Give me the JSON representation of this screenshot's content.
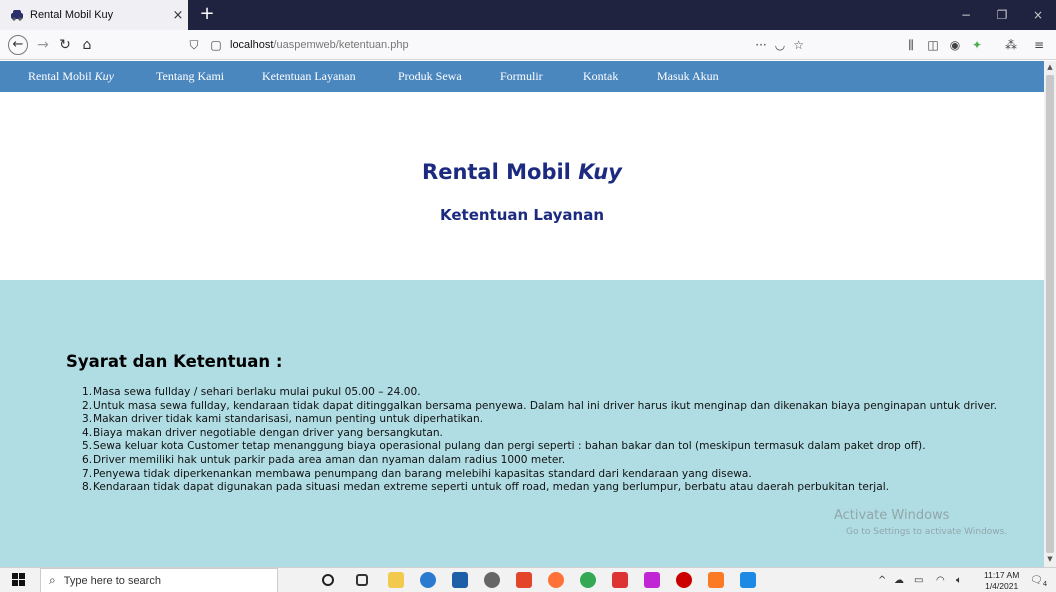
{
  "browser": {
    "tab_title": "Rental Mobil Kuy",
    "tab_close": "×",
    "new_tab": "+",
    "url_host": "localhost",
    "url_path": "/uaspemweb/ketentuan.php",
    "url_menu": "···",
    "window_controls": [
      "−",
      "❐",
      "×"
    ]
  },
  "site_nav": {
    "brand": "Rental Mobil",
    "brand_italic": "Kuy",
    "items": [
      "Tentang Kami",
      "Ketentuan Layanan",
      "Produk Sewa",
      "Formulir",
      "Kontak",
      "Masuk Akun"
    ]
  },
  "header": {
    "title": "Rental Mobil",
    "title_italic": "Kuy",
    "subtitle": "Ketentuan Layanan"
  },
  "content": {
    "section_title": "Syarat dan Ketentuan :",
    "terms": [
      "Masa sewa fullday / sehari berlaku mulai pukul 05.00 – 24.00.",
      "Untuk masa sewa fullday, kendaraan tidak dapat ditinggalkan bersama penyewa. Dalam hal ini driver harus ikut menginap dan dikenakan biaya penginapan untuk driver.",
      "Makan driver tidak kami standarisasi, namun penting untuk diperhatikan.",
      "Biaya makan driver negotiable dengan driver yang bersangkutan.",
      "Sewa keluar kota Customer tetap menanggung biaya operasional pulang dan pergi seperti : bahan bakar dan tol (meskipun termasuk dalam paket drop off).",
      "Driver memiliki hak untuk parkir pada area aman dan nyaman dalam radius 1000 meter.",
      "Penyewa tidak diperkenankan membawa penumpang dan barang melebihi kapasitas standard dari kendaraan yang disewa.",
      "Kendaraan tidak dapat digunakan pada situasi medan extreme seperti untuk off road, medan yang berlumpur, berbatu atau daerah perbukitan terjal."
    ],
    "term_numbers": [
      "1.",
      "2.",
      "3.",
      "4.",
      "5.",
      "6.",
      "7.",
      "8."
    ]
  },
  "watermark": {
    "line1": "Activate Windows",
    "line2": "Go to Settings to activate Windows."
  },
  "taskbar": {
    "search_placeholder": "Type here to search",
    "time": "11:17 AM",
    "date": "1/4/2021",
    "notification_count": "4"
  },
  "colors": {
    "nav_bg": "#4b87bf",
    "title_color": "#1c2a80",
    "content_bg": "#b0dde4",
    "tabstrip_bg": "#202340"
  }
}
